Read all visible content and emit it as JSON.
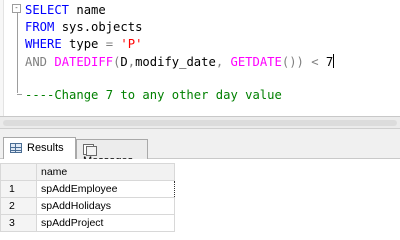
{
  "editor": {
    "outline_toggle": "-",
    "lines": [
      [
        {
          "t": "SELECT",
          "c": "kw"
        },
        {
          "t": " name",
          "c": "plain"
        }
      ],
      [
        {
          "t": "FROM",
          "c": "kw"
        },
        {
          "t": " sys.objects",
          "c": "plain"
        }
      ],
      [
        {
          "t": "WHERE",
          "c": "kw"
        },
        {
          "t": " type ",
          "c": "plain"
        },
        {
          "t": "=",
          "c": "op"
        },
        {
          "t": " ",
          "c": "plain"
        },
        {
          "t": "'P'",
          "c": "str"
        }
      ],
      [
        {
          "t": "AND",
          "c": "op"
        },
        {
          "t": " ",
          "c": "plain"
        },
        {
          "t": "DATEDIFF",
          "c": "fn"
        },
        {
          "t": "(",
          "c": "op"
        },
        {
          "t": "D",
          "c": "plain"
        },
        {
          "t": ",",
          "c": "op"
        },
        {
          "t": "modify_date",
          "c": "plain"
        },
        {
          "t": ",",
          "c": "op"
        },
        {
          "t": " ",
          "c": "plain"
        },
        {
          "t": "GETDATE",
          "c": "fn"
        },
        {
          "t": "())",
          "c": "op"
        },
        {
          "t": " ",
          "c": "plain"
        },
        {
          "t": "<",
          "c": "op"
        },
        {
          "t": " 7",
          "c": "plain"
        }
      ],
      [],
      [
        {
          "t": "----Change 7 to any other day value",
          "c": "cm"
        }
      ]
    ]
  },
  "results": {
    "tabs": [
      {
        "label": "Results",
        "icon": "results-grid-icon",
        "active": true
      },
      {
        "label": "Messages",
        "icon": "messages-icon",
        "active": false
      }
    ],
    "columns": [
      "name"
    ],
    "rows": [
      {
        "num": "1",
        "name": "spAddEmployee"
      },
      {
        "num": "2",
        "name": "spAddHolidays"
      },
      {
        "num": "3",
        "name": "spAddProject"
      }
    ]
  }
}
